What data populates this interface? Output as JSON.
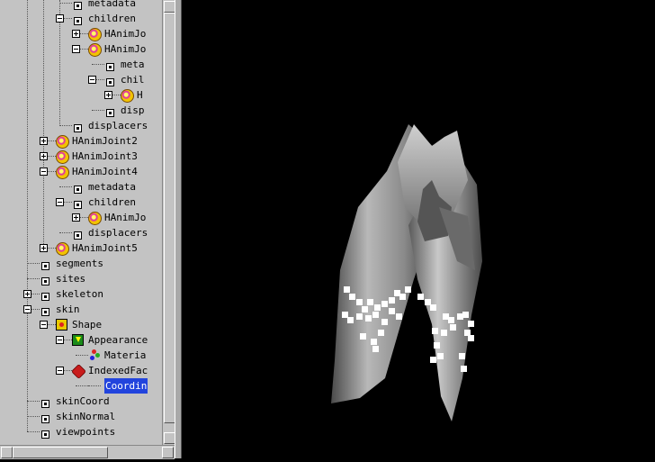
{
  "tree": {
    "nodes": [
      {
        "label": "metadata",
        "depth": 4,
        "icon": "field"
      },
      {
        "label": "children",
        "depth": 4,
        "icon": "field",
        "expander": "minus"
      },
      {
        "label": "HAnimJo",
        "depth": 5,
        "icon": "hanim",
        "expander": "plus"
      },
      {
        "label": "HAnimJo",
        "depth": 5,
        "icon": "hanim",
        "expander": "minus"
      },
      {
        "label": "meta",
        "depth": 6,
        "icon": "field"
      },
      {
        "label": "chil",
        "depth": 6,
        "icon": "field",
        "expander": "minus"
      },
      {
        "label": "H",
        "depth": 7,
        "icon": "hanim",
        "expander": "plus"
      },
      {
        "label": "disp",
        "depth": 6,
        "icon": "field"
      },
      {
        "label": "displacers",
        "depth": 4,
        "icon": "field"
      },
      {
        "label": "HAnimJoint2",
        "depth": 3,
        "icon": "hanim",
        "expander": "plus"
      },
      {
        "label": "HAnimJoint3",
        "depth": 3,
        "icon": "hanim",
        "expander": "plus"
      },
      {
        "label": "HAnimJoint4",
        "depth": 3,
        "icon": "hanim",
        "expander": "minus"
      },
      {
        "label": "metadata",
        "depth": 4,
        "icon": "field"
      },
      {
        "label": "children",
        "depth": 4,
        "icon": "field",
        "expander": "minus"
      },
      {
        "label": "HAnimJo",
        "depth": 5,
        "icon": "hanim",
        "expander": "plus"
      },
      {
        "label": "displacers",
        "depth": 4,
        "icon": "field"
      },
      {
        "label": "HAnimJoint5",
        "depth": 3,
        "icon": "hanim",
        "expander": "plus"
      },
      {
        "label": "segments",
        "depth": 2,
        "icon": "field"
      },
      {
        "label": "sites",
        "depth": 2,
        "icon": "field"
      },
      {
        "label": "skeleton",
        "depth": 2,
        "icon": "field",
        "expander": "plus"
      },
      {
        "label": "skin",
        "depth": 2,
        "icon": "field",
        "expander": "minus"
      },
      {
        "label": "Shape",
        "depth": 3,
        "icon": "shape",
        "expander": "minus"
      },
      {
        "label": "Appearance",
        "depth": 4,
        "icon": "appearance",
        "expander": "minus"
      },
      {
        "label": "Materia",
        "depth": 5,
        "icon": "material"
      },
      {
        "label": "IndexedFac",
        "depth": 4,
        "icon": "ifs",
        "expander": "minus"
      },
      {
        "label": "Coordin",
        "depth": 5,
        "icon": "coord",
        "selected": true
      },
      {
        "label": "skinCoord",
        "depth": 2,
        "icon": "field"
      },
      {
        "label": "skinNormal",
        "depth": 2,
        "icon": "field"
      },
      {
        "label": "viewpoints",
        "depth": 2,
        "icon": "field"
      }
    ]
  },
  "viewport": {
    "background": "#000000",
    "model_color": "#9a9a9a",
    "marker_color": "#ffffff"
  }
}
